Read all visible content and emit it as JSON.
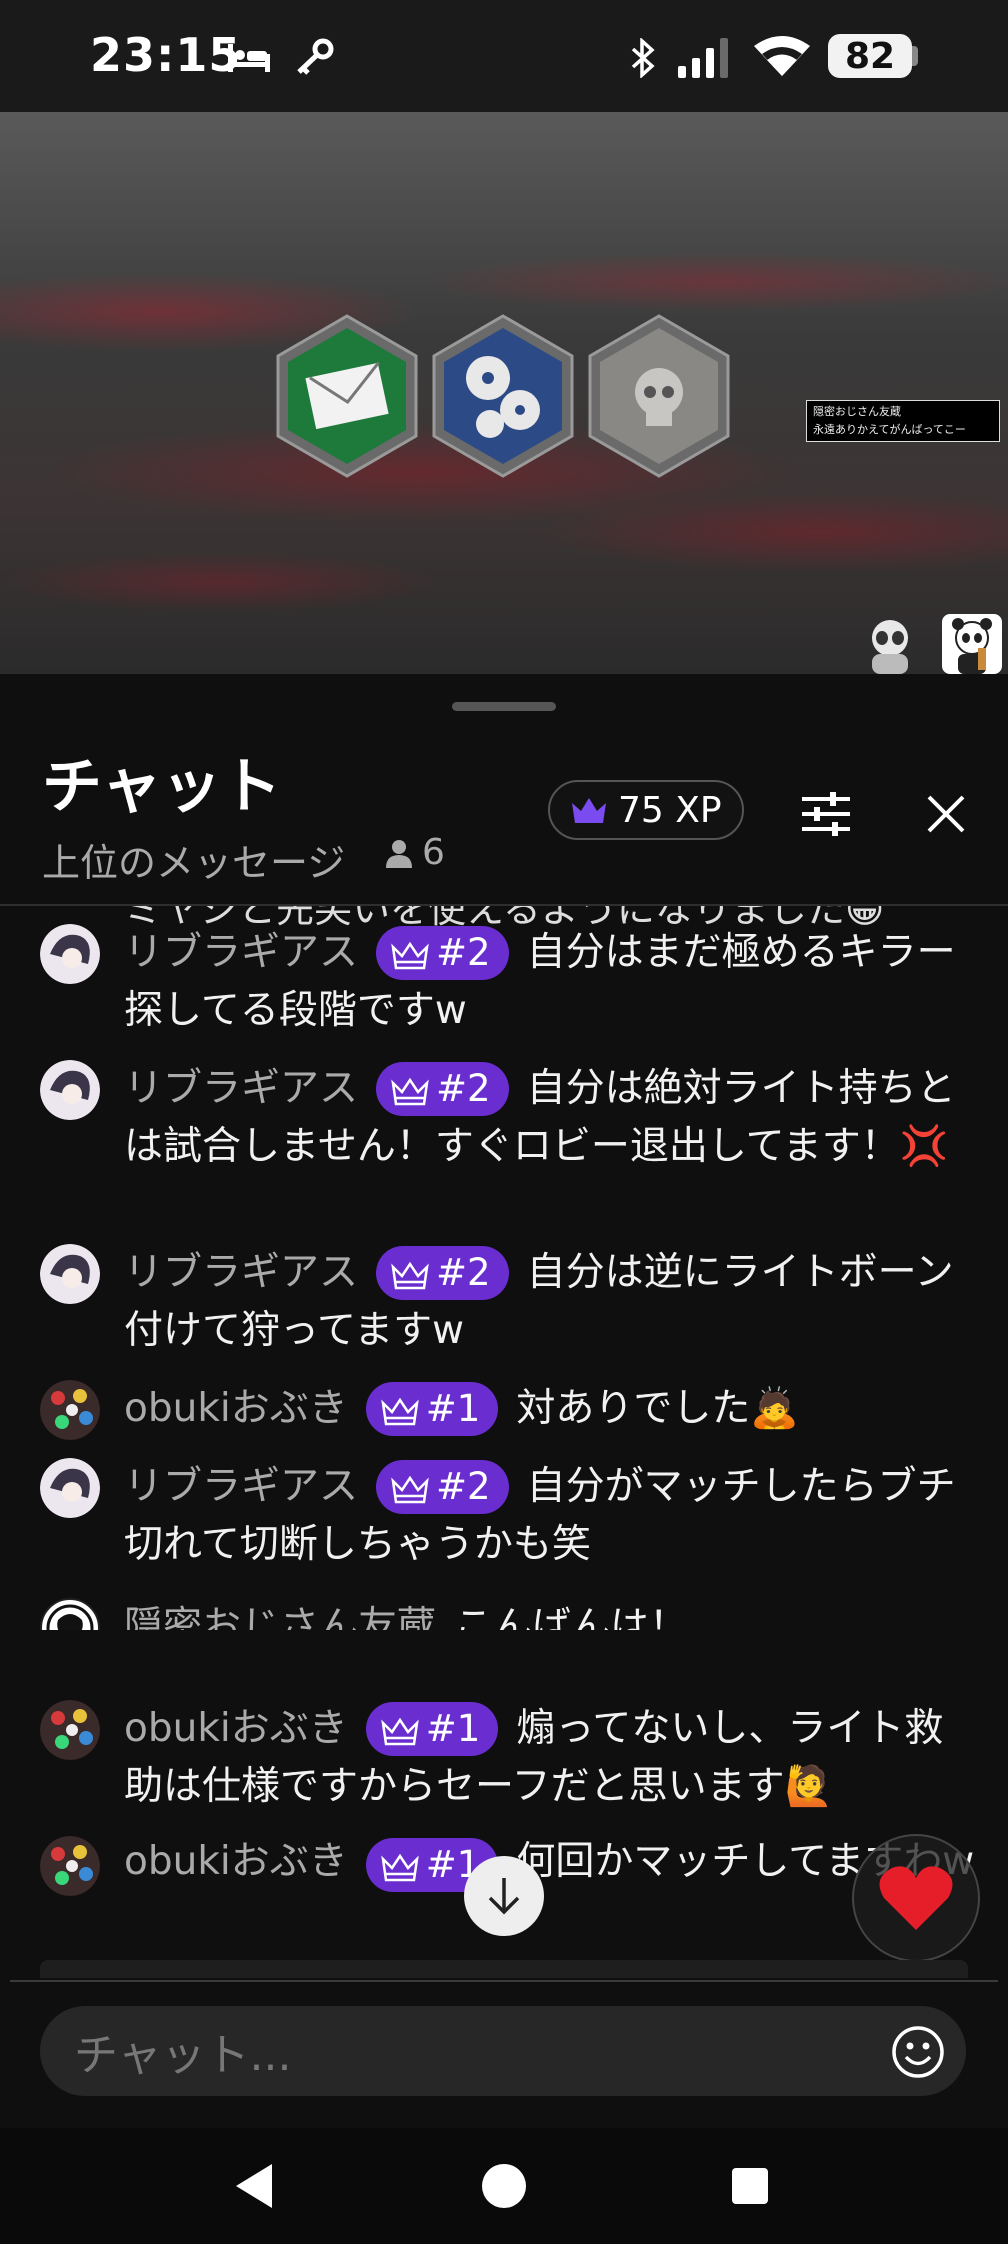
{
  "status_bar": {
    "time": "23:15",
    "battery": "82",
    "icons": [
      "bed-icon",
      "key-icon",
      "bluetooth-icon",
      "signal-icon",
      "wifi-icon"
    ]
  },
  "video": {
    "overlay_line1": "隠密おじさん友蔵",
    "overlay_line2": "永遠ありかえてがんばってこー",
    "icons": [
      "envelope-perk-icon",
      "flower-perk-icon",
      "skull-perk-icon"
    ]
  },
  "chat": {
    "title": "チャット",
    "subtitle": "上位のメッセージ",
    "viewer_count": "6",
    "xp": "75 XP",
    "partial_text": "ミヤジと先笑いを使えるようになりました😁",
    "messages": [
      {
        "user": "リブラギアス",
        "badge": "#2",
        "text": "自分はまだ極めるキラー探してる段階ですw",
        "avatar": "libra"
      },
      {
        "user": "リブラギアス",
        "badge": "#2",
        "text": "自分は絶対ライト持ちとは試合しません！すぐロビー退出してます！💢",
        "avatar": "libra"
      },
      {
        "user": "リブラギアス",
        "badge": "#2",
        "text": "自分は逆にライトボーン付けて狩ってますw",
        "avatar": "libra"
      },
      {
        "user": "obukiおぶき",
        "badge": "#1",
        "text": "対ありでした🙇",
        "avatar": "obuki"
      },
      {
        "user": "リブラギアス",
        "badge": "#2",
        "text": "自分がマッチしたらブチ切れて切断しちゃうかも笑",
        "avatar": "libra"
      },
      {
        "user": "隠密おじさん友蔵",
        "badge": "",
        "text": "こんばんは！",
        "avatar": "tomozo"
      },
      {
        "user": "obukiおぶき",
        "badge": "#1",
        "text": "煽ってないし、ライト救助は仕様ですからセーフだと思います🙋",
        "avatar": "obuki"
      },
      {
        "user": "obukiおぶき",
        "badge": "#1",
        "text": "何回かマッチしてますわw",
        "avatar": "obuki"
      }
    ],
    "input_placeholder": "チャット..."
  },
  "colors": {
    "badge": "#6a2dd0",
    "background": "#0f0f0f"
  }
}
